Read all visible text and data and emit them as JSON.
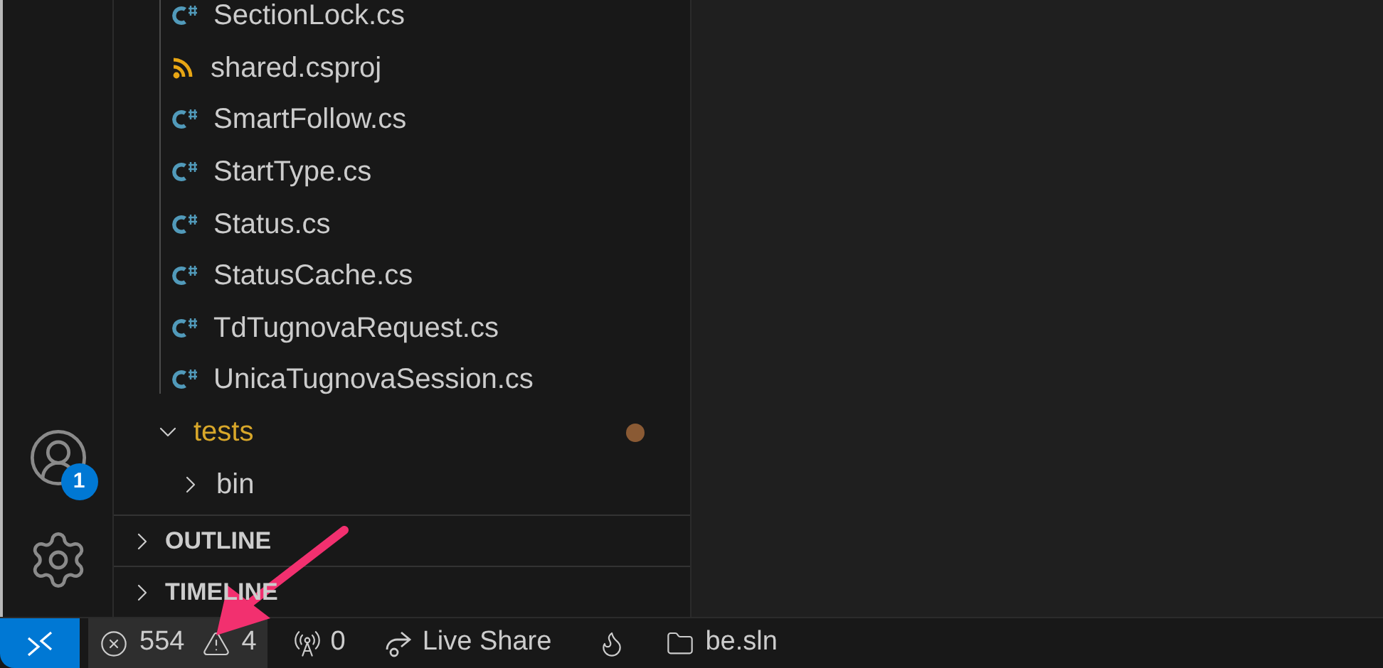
{
  "activity_bar": {
    "accounts_badge": "1"
  },
  "explorer": {
    "items": [
      {
        "kind": "csharp",
        "name": "SectionLock.cs"
      },
      {
        "kind": "project",
        "name": "shared.csproj"
      },
      {
        "kind": "csharp",
        "name": "SmartFollow.cs"
      },
      {
        "kind": "csharp",
        "name": "StartType.cs"
      },
      {
        "kind": "csharp",
        "name": "Status.cs"
      },
      {
        "kind": "csharp",
        "name": "StatusCache.cs"
      },
      {
        "kind": "csharp",
        "name": "TdTugnovaRequest.cs"
      },
      {
        "kind": "csharp",
        "name": "UnicaTugnovaSession.cs"
      },
      {
        "kind": "folder",
        "name": "tests",
        "expanded": true,
        "modified": true,
        "color": "#8a5a34",
        "children": [
          {
            "kind": "folder",
            "name": "bin",
            "expanded": false
          }
        ]
      }
    ]
  },
  "sections": [
    {
      "title": "OUTLINE",
      "expanded": false
    },
    {
      "title": "TIMELINE",
      "expanded": false
    }
  ],
  "status_bar": {
    "problems": {
      "errors": "554",
      "warnings": "4",
      "hovered": true
    },
    "ports": "0",
    "live_share": "Live Share",
    "solution": "be.sln"
  }
}
